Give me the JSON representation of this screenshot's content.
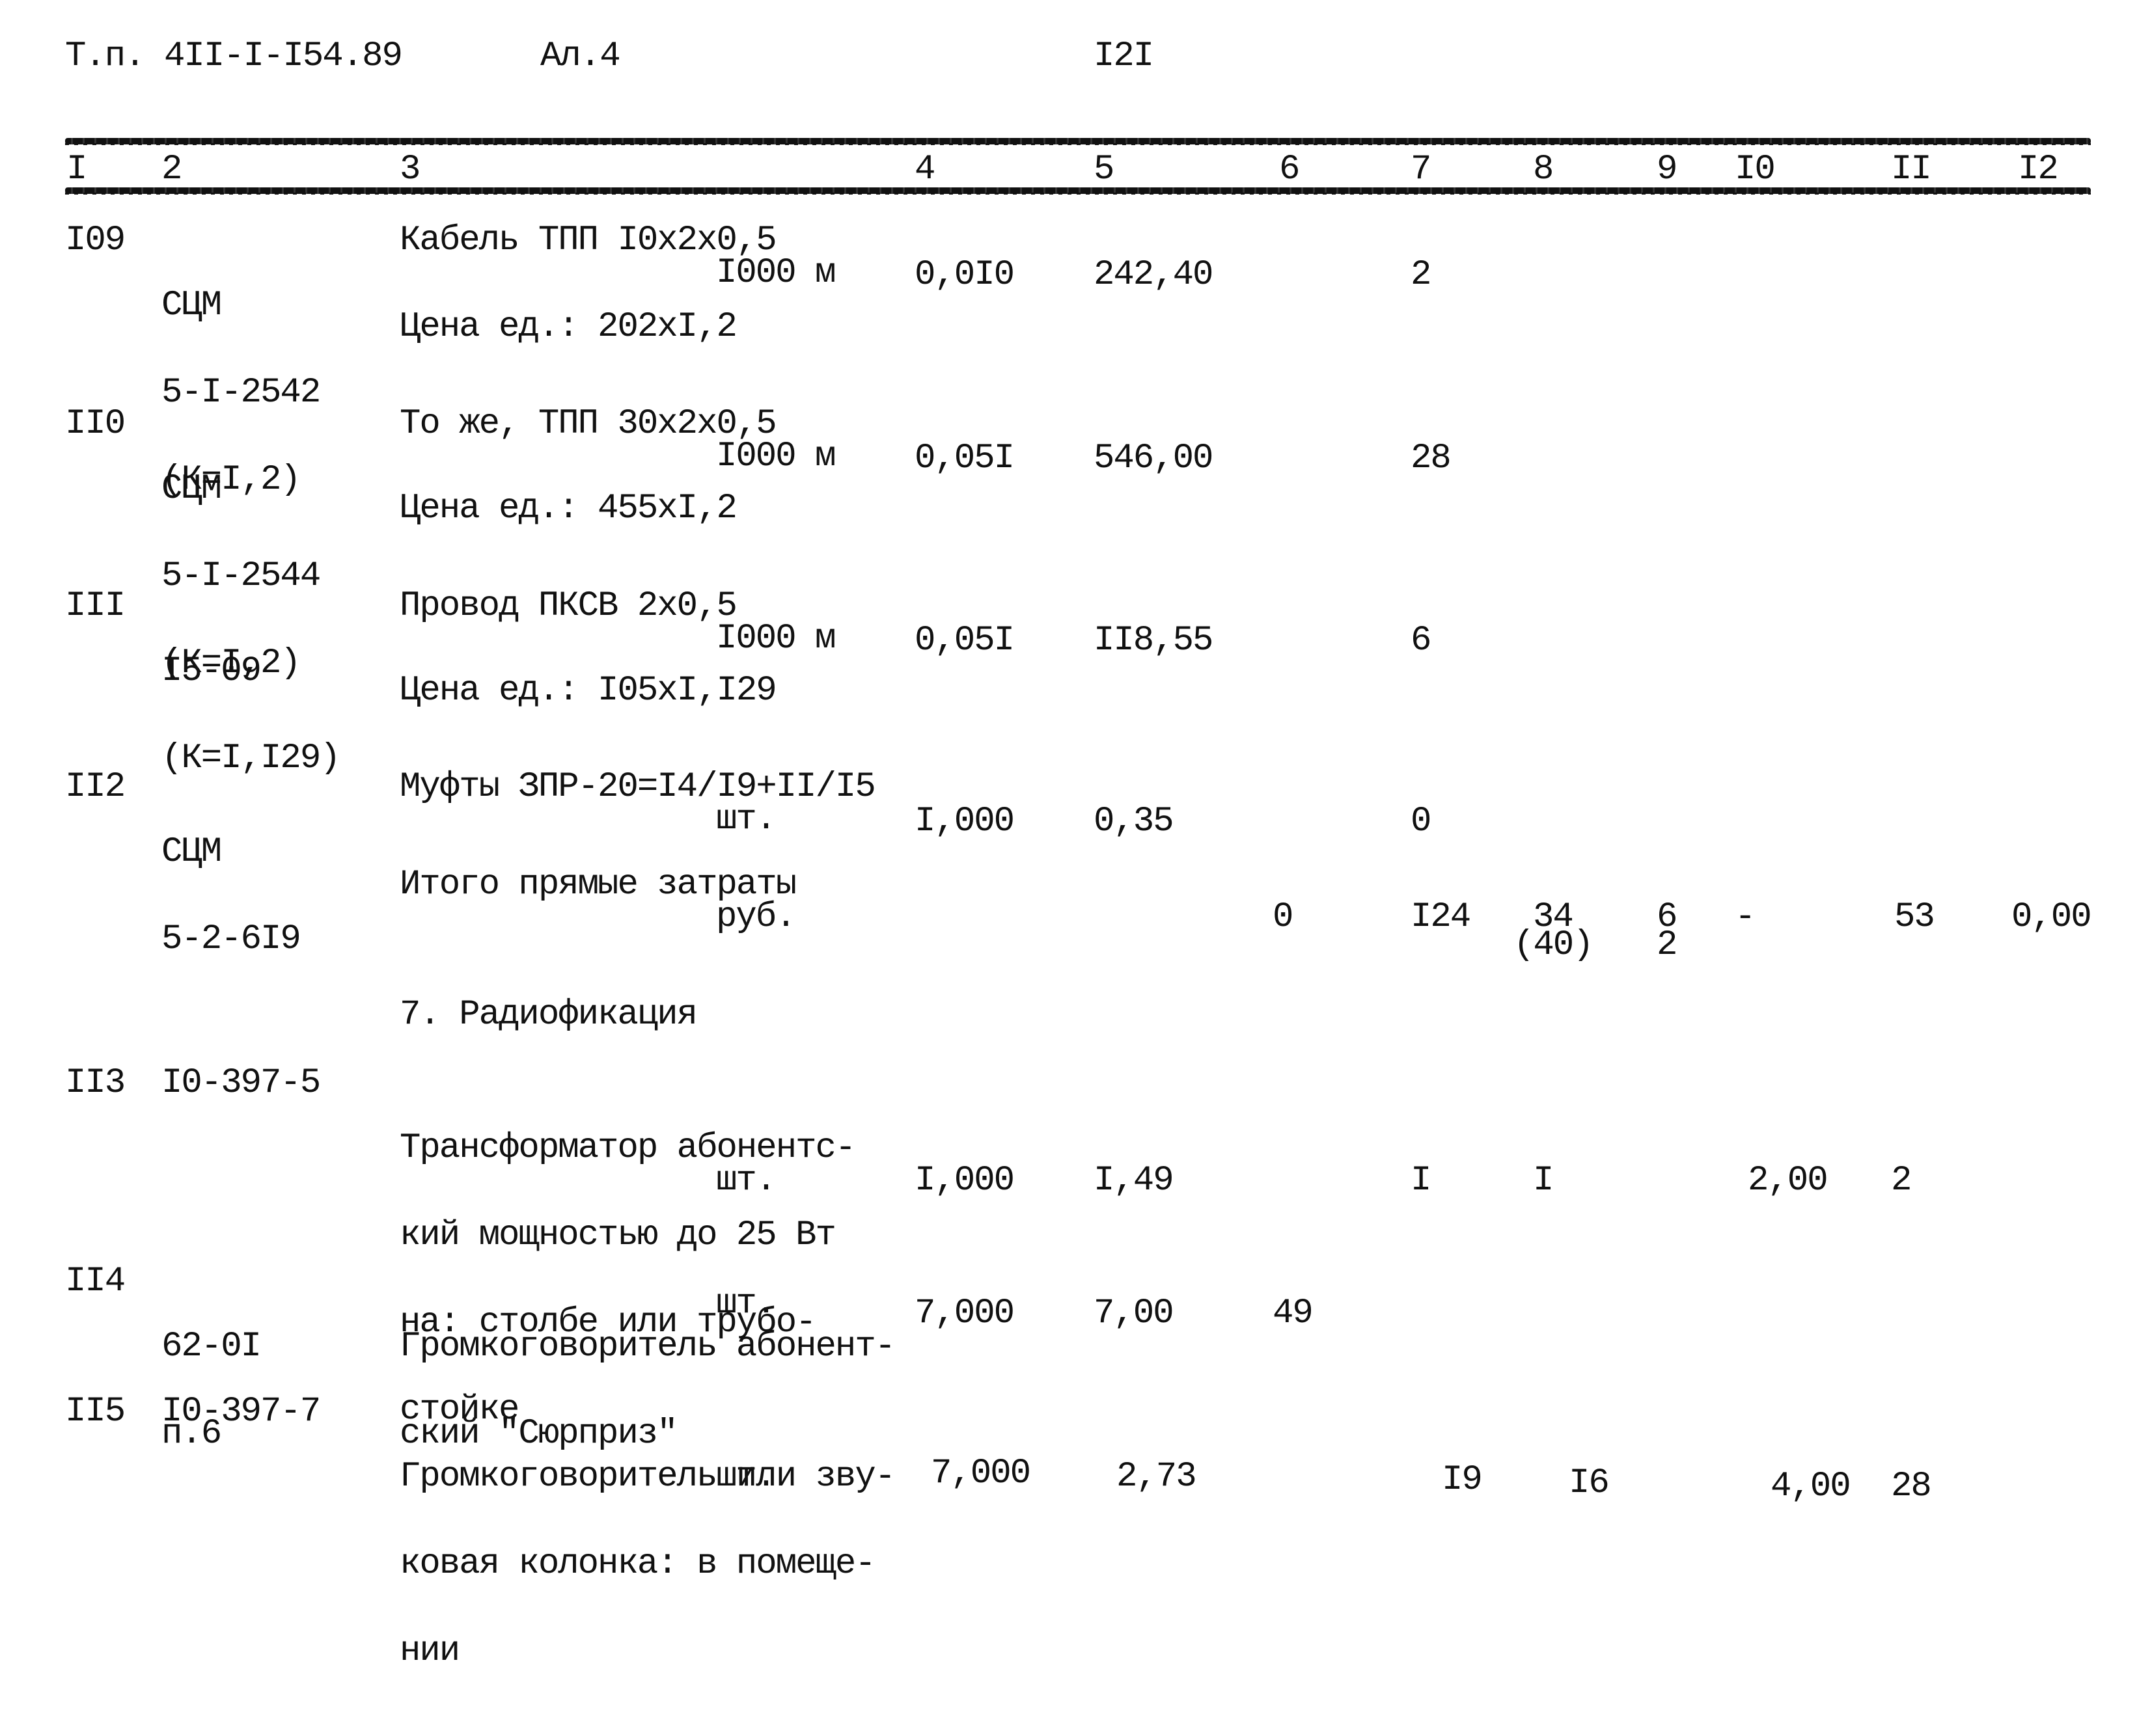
{
  "header": {
    "doc_code": "Т.п. 4II-I-I54.89",
    "album": "Ал.4",
    "page_number": "I2I"
  },
  "columns": [
    "I",
    "2",
    "3",
    "4",
    "5",
    "6",
    "7",
    "8",
    "9",
    "I0",
    "II",
    "I2"
  ],
  "rows": [
    {
      "no": "I09",
      "code": [
        "СЦМ",
        "5-I-2542",
        "(К=I,2)"
      ],
      "desc": [
        "Кабель ТПП I0x2x0,5"
      ],
      "unit": "I000 м",
      "price_note": "Цена ед.: 202xI,2",
      "c4": "0,0I0",
      "c5": "242,40",
      "c6": "",
      "c7": "2",
      "c8": "",
      "c9": "",
      "c10": "",
      "c11": "",
      "c12": ""
    },
    {
      "no": "II0",
      "code": [
        "СЦМ",
        "5-I-2544",
        "(К=I,2)"
      ],
      "desc": [
        "То же, ТПП 30x2x0,5"
      ],
      "unit": "I000 м",
      "price_note": "Цена ед.: 455xI,2",
      "c4": "0,05I",
      "c5": "546,00",
      "c6": "",
      "c7": "28",
      "c8": "",
      "c9": "",
      "c10": "",
      "c11": "",
      "c12": ""
    },
    {
      "no": "III",
      "code": [
        "I5-09",
        "(К=I,I29)"
      ],
      "desc": [
        "Провод ПКСВ 2x0,5"
      ],
      "unit": "I000 м",
      "price_note": "Цена ед.: I05xI,I29",
      "c4": "0,05I",
      "c5": "II8,55",
      "c6": "",
      "c7": "6",
      "c8": "",
      "c9": "",
      "c10": "",
      "c11": "",
      "c12": ""
    },
    {
      "no": "II2",
      "code": [
        "СЦМ",
        "5-2-6I9"
      ],
      "desc": [
        "Муфты ЗПР-20=I4/I9+II/I5"
      ],
      "unit": "шт.",
      "price_note": "",
      "c4": "I,000",
      "c5": "0,35",
      "c6": "",
      "c7": "0",
      "c8": "",
      "c9": "",
      "c10": "",
      "c11": "",
      "c12": ""
    }
  ],
  "subtotal": {
    "label": "Итого прямые затраты",
    "unit": "руб.",
    "c6": "0",
    "c7": "I24",
    "c8": "34",
    "c8_sub": "(40)",
    "c9": "6",
    "c9_sub": "2",
    "c10": "-",
    "c11": "53",
    "c12": "0,00"
  },
  "section_title": "7. Радиофикация",
  "rows2": [
    {
      "no": "II3",
      "code": [
        "I0-397-5"
      ],
      "desc": [
        "Трансформатор абонентс-",
        "кий мощностью до 25 Вт",
        "на: столбе или трубо-",
        "стойке"
      ],
      "unit": "шт.",
      "c4": "I,000",
      "c5": "I,49",
      "c6": "",
      "c7": "I",
      "c8": "I",
      "c9": "",
      "c10": "2,00",
      "c11": "2",
      "c12": ""
    },
    {
      "no": "II4",
      "code": [
        "62-0I",
        "п.6"
      ],
      "desc": [
        "Громкоговоритель абонент-",
        "ский \"Сюрприз\""
      ],
      "unit": "шт.",
      "c4": "7,000",
      "c5": "7,00",
      "c6": "49",
      "c7": "",
      "c8": "",
      "c9": "",
      "c10": "",
      "c11": "",
      "c12": ""
    },
    {
      "no": "II5",
      "code": [
        "I0-397-7"
      ],
      "desc": [
        "Громкоговоритель или зву-",
        "ковая колонка: в помеще-",
        "нии"
      ],
      "unit": "шт.",
      "c4": "7,000",
      "c5": "2,73",
      "c6": "",
      "c7": "I9",
      "c8": "I6",
      "c9": "",
      "c10": "4,00",
      "c11": "28",
      "c12": ""
    }
  ]
}
